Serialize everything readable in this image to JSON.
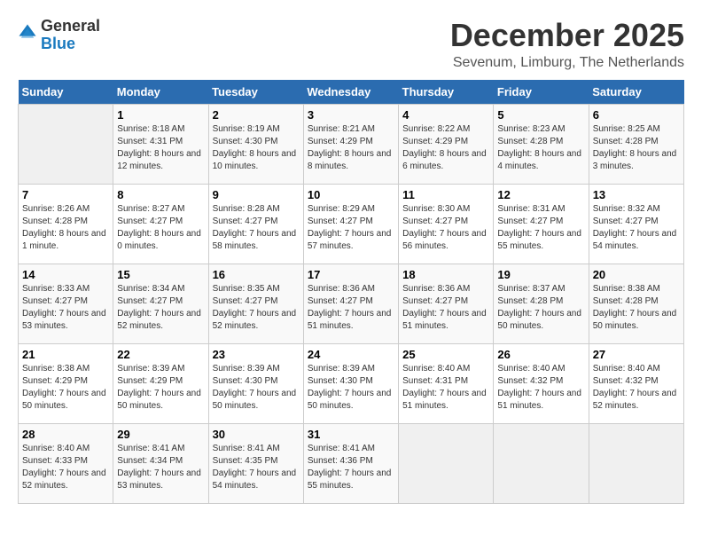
{
  "header": {
    "logo_general": "General",
    "logo_blue": "Blue",
    "month": "December 2025",
    "location": "Sevenum, Limburg, The Netherlands"
  },
  "days_of_week": [
    "Sunday",
    "Monday",
    "Tuesday",
    "Wednesday",
    "Thursday",
    "Friday",
    "Saturday"
  ],
  "weeks": [
    [
      {
        "day": "",
        "sunrise": "",
        "sunset": "",
        "daylight": "",
        "empty": true
      },
      {
        "day": "1",
        "sunrise": "Sunrise: 8:18 AM",
        "sunset": "Sunset: 4:31 PM",
        "daylight": "Daylight: 8 hours and 12 minutes."
      },
      {
        "day": "2",
        "sunrise": "Sunrise: 8:19 AM",
        "sunset": "Sunset: 4:30 PM",
        "daylight": "Daylight: 8 hours and 10 minutes."
      },
      {
        "day": "3",
        "sunrise": "Sunrise: 8:21 AM",
        "sunset": "Sunset: 4:29 PM",
        "daylight": "Daylight: 8 hours and 8 minutes."
      },
      {
        "day": "4",
        "sunrise": "Sunrise: 8:22 AM",
        "sunset": "Sunset: 4:29 PM",
        "daylight": "Daylight: 8 hours and 6 minutes."
      },
      {
        "day": "5",
        "sunrise": "Sunrise: 8:23 AM",
        "sunset": "Sunset: 4:28 PM",
        "daylight": "Daylight: 8 hours and 4 minutes."
      },
      {
        "day": "6",
        "sunrise": "Sunrise: 8:25 AM",
        "sunset": "Sunset: 4:28 PM",
        "daylight": "Daylight: 8 hours and 3 minutes."
      }
    ],
    [
      {
        "day": "7",
        "sunrise": "Sunrise: 8:26 AM",
        "sunset": "Sunset: 4:28 PM",
        "daylight": "Daylight: 8 hours and 1 minute."
      },
      {
        "day": "8",
        "sunrise": "Sunrise: 8:27 AM",
        "sunset": "Sunset: 4:27 PM",
        "daylight": "Daylight: 8 hours and 0 minutes."
      },
      {
        "day": "9",
        "sunrise": "Sunrise: 8:28 AM",
        "sunset": "Sunset: 4:27 PM",
        "daylight": "Daylight: 7 hours and 58 minutes."
      },
      {
        "day": "10",
        "sunrise": "Sunrise: 8:29 AM",
        "sunset": "Sunset: 4:27 PM",
        "daylight": "Daylight: 7 hours and 57 minutes."
      },
      {
        "day": "11",
        "sunrise": "Sunrise: 8:30 AM",
        "sunset": "Sunset: 4:27 PM",
        "daylight": "Daylight: 7 hours and 56 minutes."
      },
      {
        "day": "12",
        "sunrise": "Sunrise: 8:31 AM",
        "sunset": "Sunset: 4:27 PM",
        "daylight": "Daylight: 7 hours and 55 minutes."
      },
      {
        "day": "13",
        "sunrise": "Sunrise: 8:32 AM",
        "sunset": "Sunset: 4:27 PM",
        "daylight": "Daylight: 7 hours and 54 minutes."
      }
    ],
    [
      {
        "day": "14",
        "sunrise": "Sunrise: 8:33 AM",
        "sunset": "Sunset: 4:27 PM",
        "daylight": "Daylight: 7 hours and 53 minutes."
      },
      {
        "day": "15",
        "sunrise": "Sunrise: 8:34 AM",
        "sunset": "Sunset: 4:27 PM",
        "daylight": "Daylight: 7 hours and 52 minutes."
      },
      {
        "day": "16",
        "sunrise": "Sunrise: 8:35 AM",
        "sunset": "Sunset: 4:27 PM",
        "daylight": "Daylight: 7 hours and 52 minutes."
      },
      {
        "day": "17",
        "sunrise": "Sunrise: 8:36 AM",
        "sunset": "Sunset: 4:27 PM",
        "daylight": "Daylight: 7 hours and 51 minutes."
      },
      {
        "day": "18",
        "sunrise": "Sunrise: 8:36 AM",
        "sunset": "Sunset: 4:27 PM",
        "daylight": "Daylight: 7 hours and 51 minutes."
      },
      {
        "day": "19",
        "sunrise": "Sunrise: 8:37 AM",
        "sunset": "Sunset: 4:28 PM",
        "daylight": "Daylight: 7 hours and 50 minutes."
      },
      {
        "day": "20",
        "sunrise": "Sunrise: 8:38 AM",
        "sunset": "Sunset: 4:28 PM",
        "daylight": "Daylight: 7 hours and 50 minutes."
      }
    ],
    [
      {
        "day": "21",
        "sunrise": "Sunrise: 8:38 AM",
        "sunset": "Sunset: 4:29 PM",
        "daylight": "Daylight: 7 hours and 50 minutes."
      },
      {
        "day": "22",
        "sunrise": "Sunrise: 8:39 AM",
        "sunset": "Sunset: 4:29 PM",
        "daylight": "Daylight: 7 hours and 50 minutes."
      },
      {
        "day": "23",
        "sunrise": "Sunrise: 8:39 AM",
        "sunset": "Sunset: 4:30 PM",
        "daylight": "Daylight: 7 hours and 50 minutes."
      },
      {
        "day": "24",
        "sunrise": "Sunrise: 8:39 AM",
        "sunset": "Sunset: 4:30 PM",
        "daylight": "Daylight: 7 hours and 50 minutes."
      },
      {
        "day": "25",
        "sunrise": "Sunrise: 8:40 AM",
        "sunset": "Sunset: 4:31 PM",
        "daylight": "Daylight: 7 hours and 51 minutes."
      },
      {
        "day": "26",
        "sunrise": "Sunrise: 8:40 AM",
        "sunset": "Sunset: 4:32 PM",
        "daylight": "Daylight: 7 hours and 51 minutes."
      },
      {
        "day": "27",
        "sunrise": "Sunrise: 8:40 AM",
        "sunset": "Sunset: 4:32 PM",
        "daylight": "Daylight: 7 hours and 52 minutes."
      }
    ],
    [
      {
        "day": "28",
        "sunrise": "Sunrise: 8:40 AM",
        "sunset": "Sunset: 4:33 PM",
        "daylight": "Daylight: 7 hours and 52 minutes."
      },
      {
        "day": "29",
        "sunrise": "Sunrise: 8:41 AM",
        "sunset": "Sunset: 4:34 PM",
        "daylight": "Daylight: 7 hours and 53 minutes."
      },
      {
        "day": "30",
        "sunrise": "Sunrise: 8:41 AM",
        "sunset": "Sunset: 4:35 PM",
        "daylight": "Daylight: 7 hours and 54 minutes."
      },
      {
        "day": "31",
        "sunrise": "Sunrise: 8:41 AM",
        "sunset": "Sunset: 4:36 PM",
        "daylight": "Daylight: 7 hours and 55 minutes."
      },
      {
        "day": "",
        "sunrise": "",
        "sunset": "",
        "daylight": "",
        "empty": true
      },
      {
        "day": "",
        "sunrise": "",
        "sunset": "",
        "daylight": "",
        "empty": true
      },
      {
        "day": "",
        "sunrise": "",
        "sunset": "",
        "daylight": "",
        "empty": true
      }
    ]
  ]
}
